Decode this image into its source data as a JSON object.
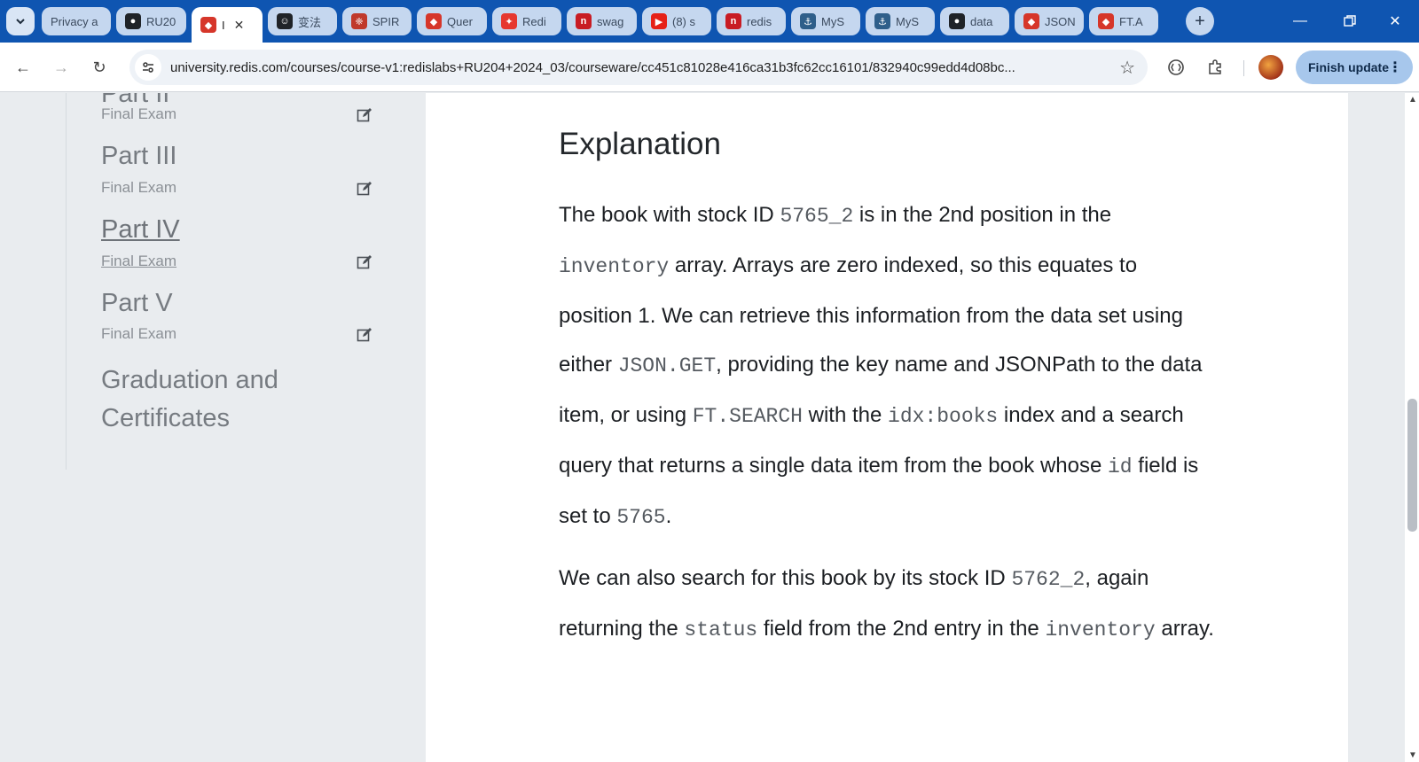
{
  "browser": {
    "tabs": [
      {
        "label": "Privacy a",
        "icon": "privacy-icon",
        "color": "#6b7b8f"
      },
      {
        "label": "RU20",
        "icon": "github-icon",
        "color": "#1f2328"
      },
      {
        "label": "I",
        "icon": "redis-cube-icon",
        "color": "#d6362a",
        "active": true
      },
      {
        "label": "变法",
        "icon": "bot-icon",
        "color": "#1f2328"
      },
      {
        "label": "SPIR",
        "icon": "crest-icon",
        "color": "#c0392b"
      },
      {
        "label": "Quer",
        "icon": "redis-cube-icon",
        "color": "#d6362a"
      },
      {
        "label": "Redi",
        "icon": "redis-logo-icon",
        "color": "#e6372f"
      },
      {
        "label": "swag",
        "icon": "n-icon",
        "color": "#c81c24"
      },
      {
        "label": "(8) s",
        "icon": "youtube-icon",
        "color": "#e62117"
      },
      {
        "label": "redis",
        "icon": "n-icon",
        "color": "#c81c24"
      },
      {
        "label": "MyS",
        "icon": "mysql-icon",
        "color": "#2f5f8a"
      },
      {
        "label": "MyS",
        "icon": "mysql-icon",
        "color": "#2f5f8a"
      },
      {
        "label": "data",
        "icon": "github-icon",
        "color": "#1f2328"
      },
      {
        "label": "JSON",
        "icon": "redis-cube-icon",
        "color": "#d6362a"
      },
      {
        "label": "FT.A",
        "icon": "redis-cube-icon",
        "color": "#d6362a"
      }
    ],
    "close_glyph": "✕",
    "url": "university.redis.com/courses/course-v1:redislabs+RU204+2024_03/courseware/cc451c81028e416ca31b3fc62cc16101/832940c99edd4d08bc...",
    "finish_update": "Finish update"
  },
  "sidebar": {
    "partial_title": "Part II",
    "first_exam": "Final Exam",
    "items": [
      {
        "title": "Part III",
        "exam": "Final Exam"
      },
      {
        "title": "Part IV",
        "exam": "Final Exam",
        "current": true
      },
      {
        "title": "Part V",
        "exam": "Final Exam"
      }
    ],
    "graduation_line1": "Graduation and",
    "graduation_line2": "Certificates"
  },
  "content": {
    "heading": "Explanation",
    "p1": {
      "t1": "The book with stock ID ",
      "c1": "5765_2",
      "t2": " is in the 2nd position in the ",
      "c2": "inventory",
      "t3": " array. Arrays are zero indexed, so this equates to position 1. We can retrieve this information from the data set using either ",
      "c3": "JSON.GET",
      "t4": ", providing the key name and JSONPath to the data item, or using ",
      "c4": "FT.SEARCH",
      "t5": " with the ",
      "c5": "idx:books",
      "t6": " index and a search query that returns a single data item from the book whose ",
      "c6": "id",
      "t7": " field is set to ",
      "c7": "5765",
      "t8": "."
    },
    "p2": {
      "t1": "We can also search for this book by its stock ID ",
      "c1": "5762_2",
      "t2": ", again returning the ",
      "c2": "status",
      "t3": " field from the 2nd entry in the ",
      "c3": "inventory",
      "t4": " array."
    }
  }
}
